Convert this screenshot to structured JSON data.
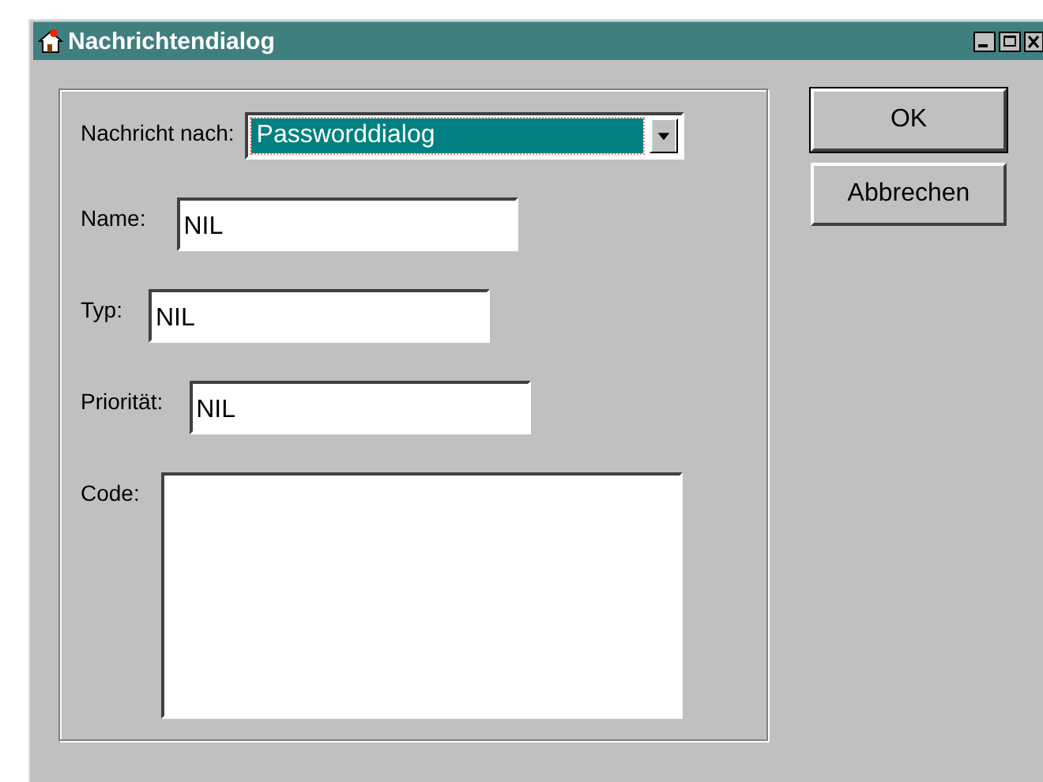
{
  "window": {
    "title": "Nachrichtendialog"
  },
  "recipient": {
    "label": "Nachricht nach:",
    "value": "Passworddialog",
    "focused": true
  },
  "fields": [
    {
      "kind": "line",
      "label": "Name:",
      "value": "NIL"
    },
    {
      "kind": "line",
      "label": "Typ:",
      "value": "NIL"
    },
    {
      "kind": "line",
      "label": "Priorität:",
      "value": "NIL"
    },
    {
      "kind": "area",
      "label": "Code:"
    }
  ],
  "buttons": [
    {
      "label": "OK",
      "default": true
    },
    {
      "label": "Abbrechen",
      "default": false
    }
  ]
}
